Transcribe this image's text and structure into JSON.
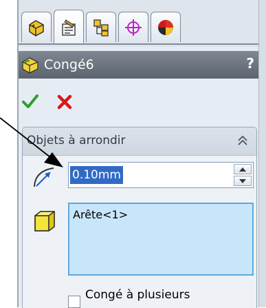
{
  "tabs": [
    {
      "name": "featuremanager-tab",
      "icon": "feature-tree-icon"
    },
    {
      "name": "propertymanager-tab",
      "icon": "property-manager-icon",
      "active": true
    },
    {
      "name": "configurationmanager-tab",
      "icon": "configuration-icon"
    },
    {
      "name": "dimxpert-tab",
      "icon": "dimxpert-crosshair-icon"
    },
    {
      "name": "display-manager-tab",
      "icon": "display-manager-icon"
    }
  ],
  "property_manager": {
    "title": "Congé6",
    "help": "?",
    "confirm_icon": "green-check-icon",
    "cancel_icon": "red-x-icon"
  },
  "group": {
    "title": "Objets à arrondir",
    "collapse_icon": "double-chevron-up-icon",
    "radius": {
      "value": "0.10mm",
      "icon": "radius-icon"
    },
    "selection": {
      "icon": "yellow-cube-icon",
      "items": [
        "Arête<1>"
      ]
    },
    "multi_radius": {
      "label": "Congé à plusieurs",
      "checked": false
    }
  },
  "colors": {
    "panel": "#e6ecf3",
    "title_bar": "#6b737e",
    "selection_bg": "#c8e6fa",
    "selection_border": "#5da9dc",
    "highlight": "#316ac5"
  }
}
